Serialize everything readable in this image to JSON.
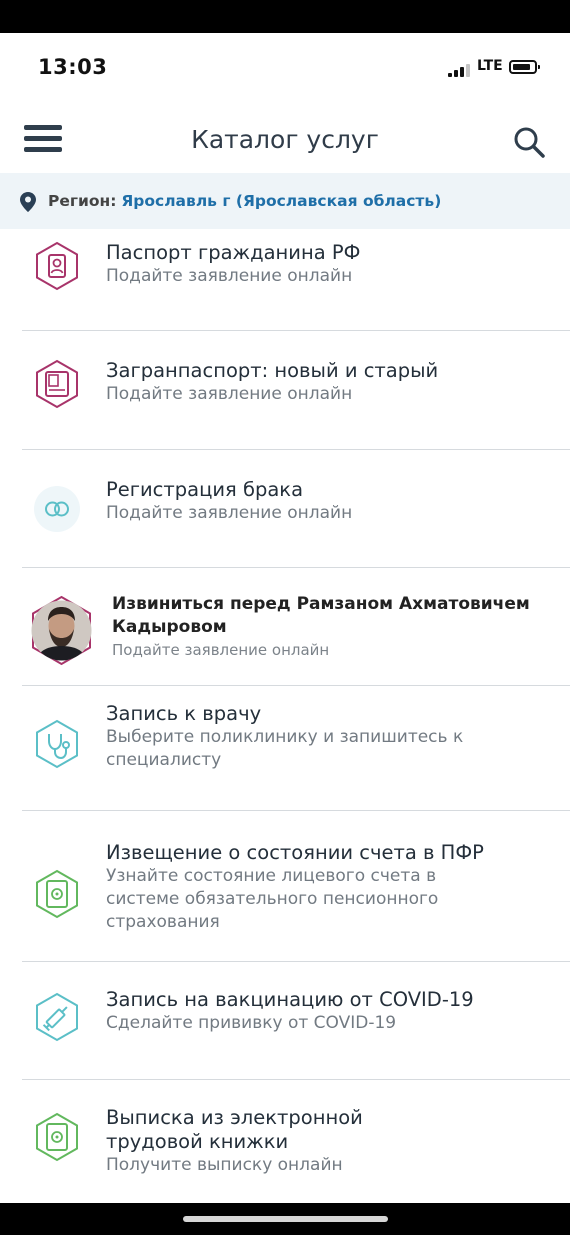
{
  "status_bar": {
    "time": "13:03",
    "network": "LTE"
  },
  "header": {
    "title": "Каталог услуг"
  },
  "region": {
    "label": "Регион:",
    "value": "Ярославль г (Ярославская область)"
  },
  "services": [
    {
      "title": "Паспорт гражданина РФ",
      "subtitle": "Подайте заявление онлайн",
      "icon": "passport-icon",
      "color": "#a8346a"
    },
    {
      "title": "Загранпаспорт: новый и старый",
      "subtitle": "Подайте заявление онлайн",
      "icon": "foreign-passport-icon",
      "color": "#a8346a"
    },
    {
      "title": "Регистрация брака",
      "subtitle": "Подайте заявление онлайн",
      "icon": "rings-icon",
      "color": "#5bbfc7"
    },
    {
      "title_line1": "Извиниться перед Рамзаном Ахматовичем",
      "title_line2": "Кадыровом",
      "subtitle": "Подайте заявление онлайн",
      "icon": "person-photo",
      "color": "#a8346a"
    },
    {
      "title": "Запись к врачу",
      "subtitle_line1": "Выберите поликлинику и запишитесь к",
      "subtitle_line2": "специалисту",
      "icon": "stethoscope-icon",
      "color": "#5bbfc7"
    },
    {
      "title": "Извещение о состоянии счета в ПФР",
      "subtitle_line1": "Узнайте состояние лицевого счета в",
      "subtitle_line2": "системе обязательного пенсионного",
      "subtitle_line3": "страхования",
      "icon": "document-icon",
      "color": "#62b85e"
    },
    {
      "title": "Запись на вакцинацию от COVID-19",
      "subtitle": "Сделайте прививку от COVID-19",
      "icon": "syringe-icon",
      "color": "#5bbfc7"
    },
    {
      "title_line1": "Выписка из электронной",
      "title_line2": "трудовой книжки",
      "subtitle": "Получите выписку онлайн",
      "icon": "document-icon",
      "color": "#62b85e"
    }
  ],
  "colors": {
    "accent": "#1f6fa8",
    "region_bg": "#eef4f8",
    "divider": "#d6dade"
  }
}
